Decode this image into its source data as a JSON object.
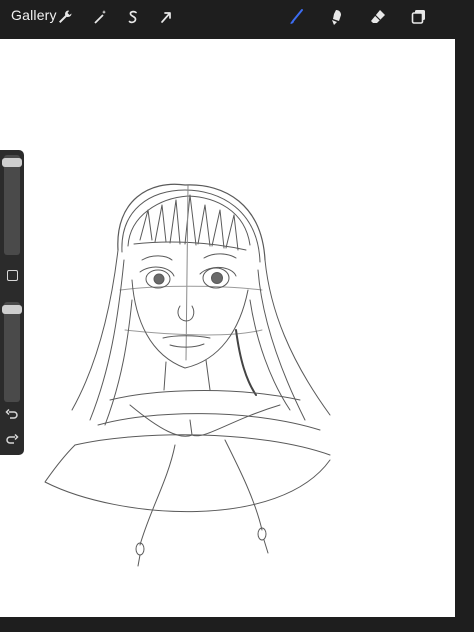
{
  "toolbar": {
    "gallery_label": "Gallery",
    "left_tools": [
      "actions-wrench-icon",
      "adjustments-wand-icon",
      "selection-s-icon",
      "transform-arrow-icon"
    ],
    "right_tools": [
      "brush-icon",
      "smudge-icon",
      "eraser-icon",
      "layers-icon"
    ],
    "active_tool": "brush-icon",
    "accent_color": "#3d6df2"
  },
  "sidebar": {
    "brush_size_level": 0.97,
    "opacity_level": 0.97,
    "icons": [
      "modify-square-icon",
      "undo-icon",
      "redo-icon"
    ]
  },
  "canvas": {
    "background_color": "#ffffff",
    "content": "pencil-sketch-girl-portrait"
  }
}
